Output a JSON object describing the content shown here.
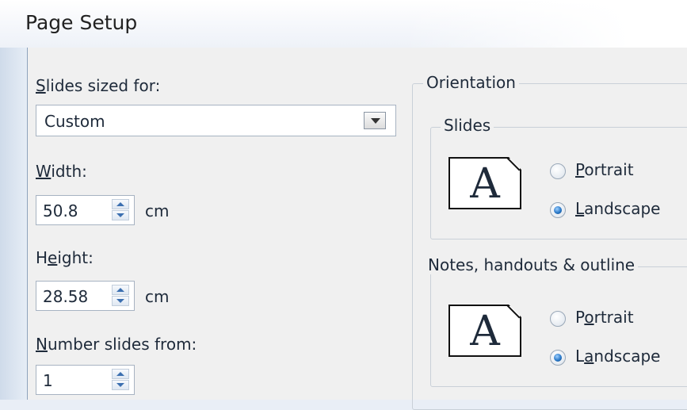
{
  "window": {
    "title": "Page Setup"
  },
  "left": {
    "slides_sized_for": {
      "label_prefix": "",
      "label_accel": "S",
      "label_rest": "lides sized for:",
      "value": "Custom"
    },
    "width": {
      "label_accel": "W",
      "label_rest": "idth:",
      "value": "50.8",
      "unit": "cm"
    },
    "height": {
      "label_prefix": "H",
      "label_accel": "e",
      "label_rest": "ight:",
      "value": "28.58",
      "unit": "cm"
    },
    "number_from": {
      "label_accel": "N",
      "label_rest": "umber slides from:",
      "value": "1"
    }
  },
  "orientation": {
    "title": "Orientation",
    "slides": {
      "title": "Slides",
      "icon_letter": "A",
      "portrait_accel": "P",
      "portrait_rest": "ortrait",
      "landscape_accel": "L",
      "landscape_rest": "andscape",
      "selected": "landscape"
    },
    "notes": {
      "title": "Notes, handouts & outline",
      "icon_letter": "A",
      "portrait_prefix": "P",
      "portrait_accel": "o",
      "portrait_rest": "rtrait",
      "landscape_prefix": "L",
      "landscape_accel": "a",
      "landscape_rest": "ndscape",
      "selected": "landscape"
    }
  }
}
